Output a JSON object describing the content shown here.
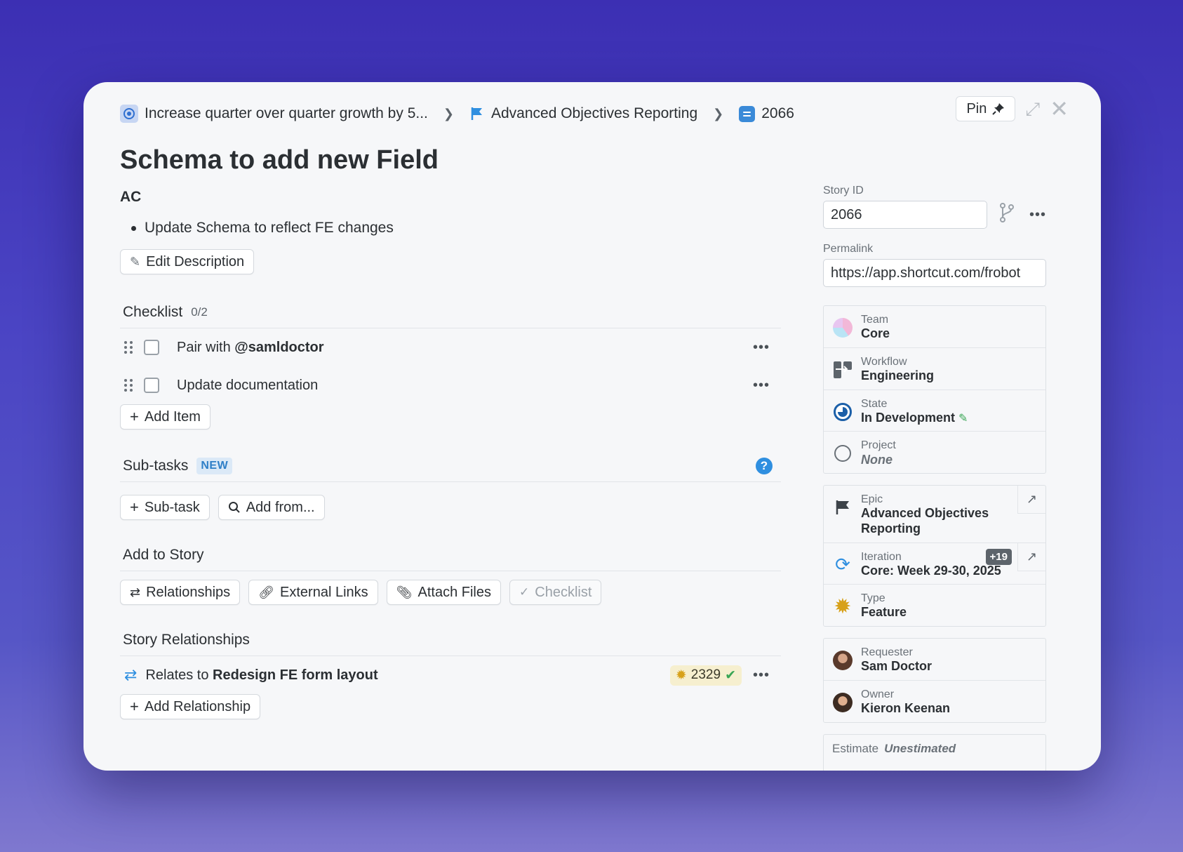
{
  "breadcrumb": {
    "objective": "Increase quarter over quarter growth by 5...",
    "epic": "Advanced Objectives Reporting",
    "story_id": "2066"
  },
  "actions": {
    "pin": "Pin"
  },
  "story": {
    "title": "Schema to add new Field",
    "description_heading": "AC",
    "description_bullet": "Update Schema to reflect FE changes",
    "edit_description": "Edit Description"
  },
  "checklist": {
    "heading": "Checklist",
    "count": "0/2",
    "items": [
      {
        "prefix": "Pair with ",
        "mention": "@samldoctor"
      },
      {
        "prefix": "Update documentation",
        "mention": ""
      }
    ],
    "add_item": "Add Item"
  },
  "subtasks": {
    "heading": "Sub-tasks",
    "badge": "NEW",
    "add_subtask": "Sub-task",
    "add_from": "Add from..."
  },
  "add_to_story": {
    "heading": "Add to Story",
    "buttons": [
      "Relationships",
      "External Links",
      "Attach Files",
      "Checklist"
    ]
  },
  "relationships": {
    "heading": "Story Relationships",
    "items": [
      {
        "verb": "Relates to ",
        "title": "Redesign FE form layout",
        "id": "2329"
      }
    ],
    "add": "Add Relationship"
  },
  "sidebar": {
    "story_id_label": "Story ID",
    "story_id_value": "2066",
    "permalink_label": "Permalink",
    "permalink_value": "https://app.shortcut.com/frobot",
    "team": {
      "label": "Team",
      "value": "Core"
    },
    "workflow": {
      "label": "Workflow",
      "value": "Engineering"
    },
    "state": {
      "label": "State",
      "value": "In Development"
    },
    "project": {
      "label": "Project",
      "value": "None"
    },
    "epic": {
      "label": "Epic",
      "value_line1": "Advanced Objectives",
      "value_line2": "Reporting"
    },
    "iteration": {
      "label": "Iteration",
      "value": "Core: Week 29-30, 2025",
      "extra": "+19"
    },
    "type": {
      "label": "Type",
      "value": "Feature"
    },
    "requester": {
      "label": "Requester",
      "value": "Sam Doctor"
    },
    "owner": {
      "label": "Owner",
      "value": "Kieron Keenan"
    },
    "estimate": {
      "label": "Estimate",
      "value": "Unestimated"
    }
  },
  "colors": {
    "accent": "#2f8fe0",
    "state": "#1b5fa8",
    "feature": "#d7a11a"
  }
}
